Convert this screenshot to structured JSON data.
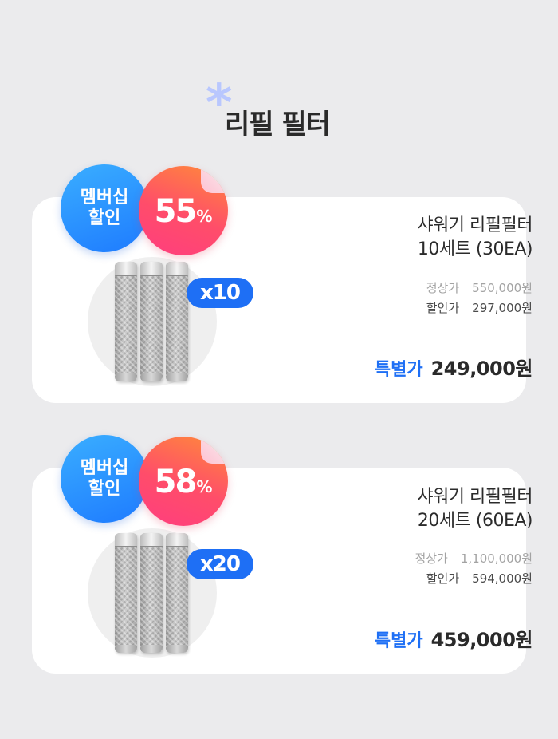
{
  "header": {
    "title": "리필 필터",
    "icon": "asterisk-icon"
  },
  "colors": {
    "accent": "#1e6ff5",
    "badge_blue": "#2d8cff",
    "badge_pink": "#ff4d6a",
    "background": "#ebebed"
  },
  "products": [
    {
      "member_badge": [
        "멤버십",
        "할인"
      ],
      "discount_num": "55",
      "discount_pct": "%",
      "qty": "x10",
      "name_line1": "샤워기 리필필터",
      "name_line2": "10세트 (30EA)",
      "regular_label": "정상가",
      "regular_price": "550,000원",
      "discount_label": "할인가",
      "discount_price": "297,000원",
      "special_label": "특별가",
      "special_price": "249,000원"
    },
    {
      "member_badge": [
        "멤버십",
        "할인"
      ],
      "discount_num": "58",
      "discount_pct": "%",
      "qty": "x20",
      "name_line1": "샤워기 리필필터",
      "name_line2": "20세트 (60EA)",
      "regular_label": "정상가",
      "regular_price": "1,100,000원",
      "discount_label": "할인가",
      "discount_price": "594,000원",
      "special_label": "특별가",
      "special_price": "459,000원"
    }
  ]
}
